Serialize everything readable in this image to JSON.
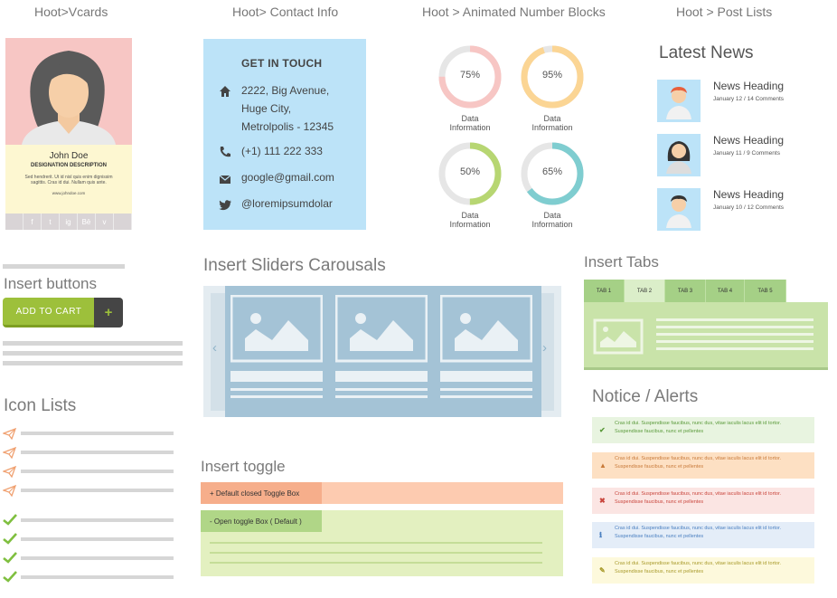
{
  "section_titles": {
    "vcards": "Hoot>Vcards",
    "contact": "Hoot> Contact Info",
    "numbers": "Hoot > Animated Number Blocks",
    "posts": "Hoot > Post Lists",
    "buttons": "Insert buttons",
    "sliders": "Insert Sliders Carousals",
    "tabs": "Insert Tabs",
    "icon_lists": "Icon Lists",
    "toggle": "Insert toggle",
    "notice": "Notice / Alerts"
  },
  "vcard": {
    "name": "John Doe",
    "designation": "DESIGNATION DESCRIPTION",
    "description": "Sed hendrerit. Ut id nisl quis enim dignissim sagittis. Cras id dui. Nullam quis ante.",
    "website": "www.johndoe.com",
    "social": [
      "f",
      "t",
      "ig",
      "Bē",
      "v"
    ],
    "colors": {
      "photo_bg": "#f7c6c4",
      "info_bg": "#fdf7d1",
      "social_bg": "#d9d4d6"
    }
  },
  "contact": {
    "heading": "GET IN TOUCH",
    "address_lines": [
      "2222, Big Avenue,",
      "Huge City,",
      "Metrolpolis - 12345"
    ],
    "phone": "(+1) 111 222 333",
    "email": "google@gmail.com",
    "twitter": "@loremipsumdolar",
    "icons": [
      "home-icon",
      "phone-icon",
      "envelope-icon",
      "twitter-icon"
    ],
    "bg_color": "#bce3f8"
  },
  "number_blocks": [
    {
      "value": 75,
      "label": "75%",
      "caption1": "Data",
      "caption2": "Information",
      "color": "#f7c6c4"
    },
    {
      "value": 95,
      "label": "95%",
      "caption1": "Data",
      "caption2": "Information",
      "color": "#fbd594"
    },
    {
      "value": 50,
      "label": "50%",
      "caption1": "Data",
      "caption2": "Information",
      "color": "#b7d672"
    },
    {
      "value": 65,
      "label": "65%",
      "caption1": "Data",
      "caption2": "Information",
      "color": "#7fcdd0"
    }
  ],
  "news": {
    "title": "Latest News",
    "items": [
      {
        "heading": "News Heading",
        "meta": "January 12 / 14 Comments"
      },
      {
        "heading": "News Heading",
        "meta": "January 11 / 9 Comments"
      },
      {
        "heading": "News Heading",
        "meta": "January 10 / 12 Comments"
      }
    ]
  },
  "buttons": {
    "add_to_cart": "ADD TO CART",
    "plus": "+",
    "colors": {
      "primary": "#9dc03b",
      "dark": "#454545"
    }
  },
  "tabs": {
    "labels": [
      "TAB 1",
      "TAB 2",
      "TAB 3",
      "TAB 4",
      "TAB 5"
    ],
    "active": "TAB 2",
    "colors": {
      "tab": "#a5d086",
      "active": "#dbeec9",
      "panel": "#c9e3a9"
    }
  },
  "toggles": {
    "closed": "+ Default closed Toggle Box",
    "open": "- Open toggle Box ( Default )",
    "colors": {
      "closed_head": "#f6ae8b",
      "closed_bar": "#fdcbb0",
      "open_head": "#b0d687",
      "open_body": "#e3f0c0"
    }
  },
  "alerts": [
    {
      "type": "success",
      "icon": "check-icon",
      "line1": "Cras id dui. Suspendisse faucibus, nunc dus, vitae iaculis lacus elit id tortor.",
      "line2": "Suspendisse faucibus, nunc et pellentes",
      "bg": "#e8f4e0",
      "color": "#5a9a3a"
    },
    {
      "type": "warning",
      "icon": "warning-icon",
      "line1": "Cras id dui. Suspendisse faucibus, nunc dus, vitae iaculis lacus elit id tortor.",
      "line2": "Suspendisse faucibus, nunc et pellentes",
      "bg": "#fde0c3",
      "color": "#c87a3a"
    },
    {
      "type": "error",
      "icon": "close-icon",
      "line1": "Cras id dui. Suspendisse faucibus, nunc dus, vitae iaculis lacus elit id tortor.",
      "line2": "Suspendisse faucibus, nunc et pellentes",
      "bg": "#fbe5e3",
      "color": "#c9463d"
    },
    {
      "type": "info",
      "icon": "info-icon",
      "line1": "Cras id dui. Suspendisse faucibus, nunc dus, vitae iaculis lacus elit id tortor.",
      "line2": "Suspendisse faucibus, nunc et pellentes",
      "bg": "#e4edf8",
      "color": "#4a7fc0"
    },
    {
      "type": "note",
      "icon": "pencil-icon",
      "line1": "Cras id dui. Suspendisse faucibus, nunc dus, vitae iaculis lacus elit id tortor.",
      "line2": "Suspendisse faucibus, nunc et pellentes",
      "bg": "#fdf9dc",
      "color": "#a89a2a"
    }
  ],
  "icon_list_icons": [
    "paper-plane-icon",
    "check-icon"
  ],
  "colors": {
    "accent_orange": "#f0a070",
    "accent_green": "#7fbf3f",
    "slider_blue": "#a4c3d6"
  }
}
